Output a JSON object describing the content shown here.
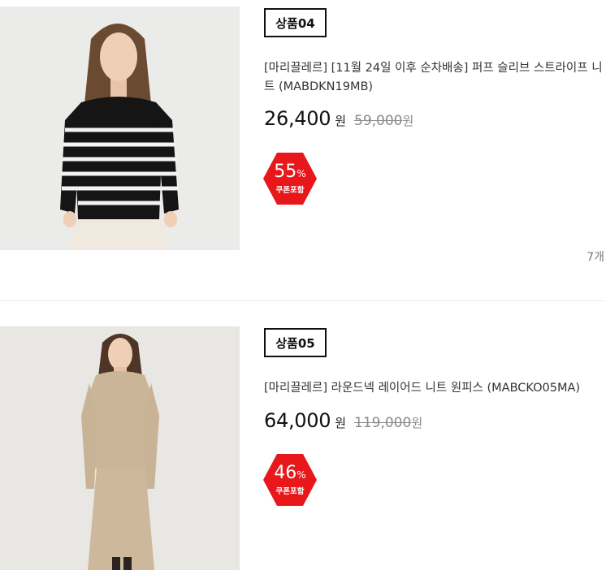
{
  "products": [
    {
      "badge": "상품04",
      "title": "[마리끌레르] [11월 24일 이후 순차배송] 퍼프 슬리브 스트라이프 니트 (MABDKN19MB)",
      "price": "26,400",
      "price_unit": "원",
      "original_price": "59,000",
      "original_unit": "원",
      "discount": "55",
      "discount_unit": "%",
      "discount_label": "쿠폰포함",
      "count": "7개",
      "image_icon": "striped-knit-photo"
    },
    {
      "badge": "상품05",
      "title": "[마리끌레르] 라운드넥 레이어드 니트 원피스 (MABCKO05MA)",
      "price": "64,000",
      "price_unit": "원",
      "original_price": "119,000",
      "original_unit": "원",
      "discount": "46",
      "discount_unit": "%",
      "discount_label": "쿠폰포함",
      "image_icon": "knit-dress-photo"
    }
  ],
  "colors": {
    "discount_badge": "#e8171b",
    "badge_border": "#111111",
    "strike_price": "#8a8a8a"
  }
}
